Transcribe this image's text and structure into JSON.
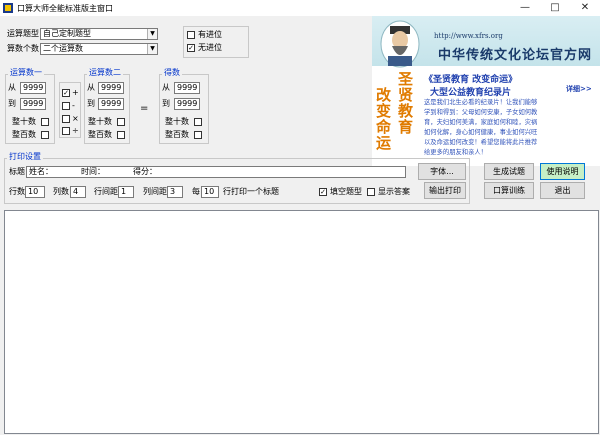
{
  "window": {
    "title": "口算大师全能标准版主窗口",
    "minimize_glyph": "—",
    "maximize_glyph": "□",
    "close_glyph": "✕"
  },
  "settings": {
    "question_type_label": "运算题型",
    "question_type_value": "自己定制题型",
    "operand_count_label": "算数个数",
    "operand_count_value": "二个运算数",
    "carry_label": "有进位",
    "carry_checked": "",
    "borrow_label": "无进位",
    "borrow_checked": "✓"
  },
  "operand1": {
    "title": "运算数一",
    "from_label": "从",
    "from_value": "9999",
    "to_label": "到",
    "to_value": "9999",
    "tens_label": "整十数",
    "hundreds_label": "整百数"
  },
  "operators": {
    "plus_checked": "✓",
    "plus": "+",
    "minus": "-",
    "times": "×",
    "divide": "÷"
  },
  "operand2": {
    "title": "运算数二",
    "from_label": "从",
    "from_value": "9999",
    "to_label": "到",
    "to_value": "9999",
    "tens_label": "整十数",
    "hundreds_label": "整百数"
  },
  "equals": "=",
  "result": {
    "title": "得数",
    "from_label": "从",
    "from_value": "9999",
    "to_label": "到",
    "to_value": "9999",
    "tens_label": "整十数",
    "hundreds_label": "整百数"
  },
  "ad": {
    "url": "http://www.xfrs.org",
    "site_name": "中华传统文化论坛官方网",
    "vertical_right": [
      "圣",
      "贤",
      "教",
      "育"
    ],
    "vertical_left": [
      "改",
      "变",
      "命",
      "运"
    ],
    "headline": "《圣贤教育  改变命运》",
    "subheadline": "大型公益教育纪录片",
    "detail_link": "详细>>",
    "body_lines": [
      "这是我们北生必看的纪录片！让我们能够",
      "学到和得到：父母如何安康，子女如何教",
      "育，夫妇如何美满，家庭如何和睦，灾祸",
      "如何化解，身心如何健康，事业如何兴旺",
      "以及命运如何改变！希望您能将此片推荐",
      "给更多的朋友和亲人！"
    ],
    "banner_small": "圣贤教育 改变命运"
  },
  "print": {
    "section_title": "打印设置",
    "title_label": "标题",
    "title_value": "姓名：           时间：           得分：",
    "font_button": "字体...",
    "rows_label": "行数",
    "rows_value": "10",
    "cols_label": "列数",
    "cols_value": "4",
    "row_spacing_label": "行间距",
    "row_spacing_value": "1",
    "col_spacing_label": "列间距",
    "col_spacing_value": "3",
    "every_label": "每",
    "every_value": "10",
    "every_suffix": "行打印一个标题",
    "fill_blank_label": "填空题型",
    "fill_blank_checked": "✓",
    "show_answer_label": "显示答案",
    "show_answer_checked": "",
    "print_button": "输出打印"
  },
  "actions": {
    "generate": "生成试题",
    "help": "使用说明",
    "drill": "口算训练",
    "exit": "退出"
  }
}
